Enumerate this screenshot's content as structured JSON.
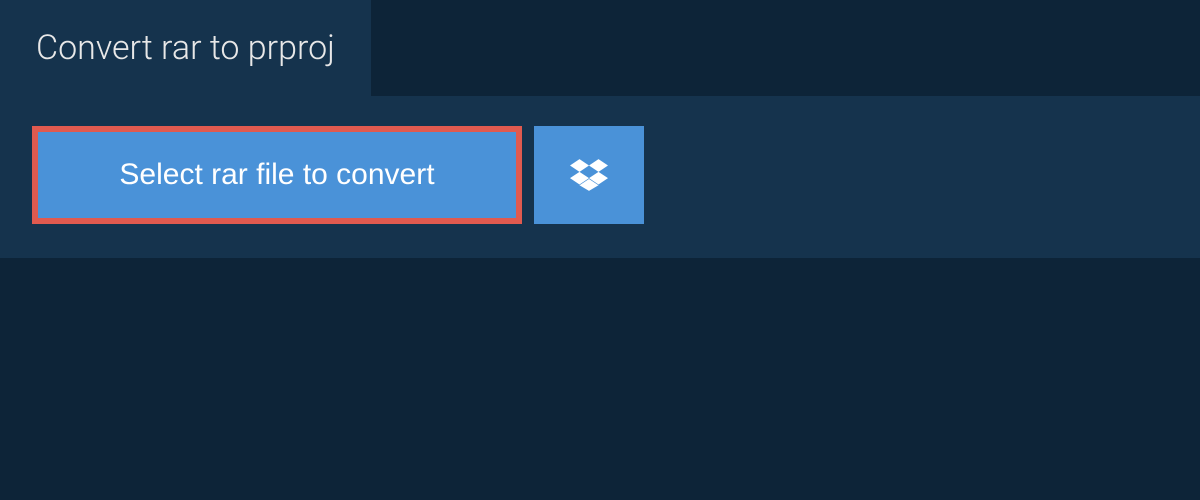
{
  "header": {
    "title": "Convert rar to prproj"
  },
  "actions": {
    "select_file_label": "Select rar file to convert",
    "dropbox_icon": "dropbox-icon"
  },
  "colors": {
    "background": "#0d2438",
    "panel": "#15334d",
    "button": "#4a92d8",
    "highlight_border": "#e05a4f",
    "text_light": "#e8e8e8",
    "text_white": "#ffffff"
  }
}
